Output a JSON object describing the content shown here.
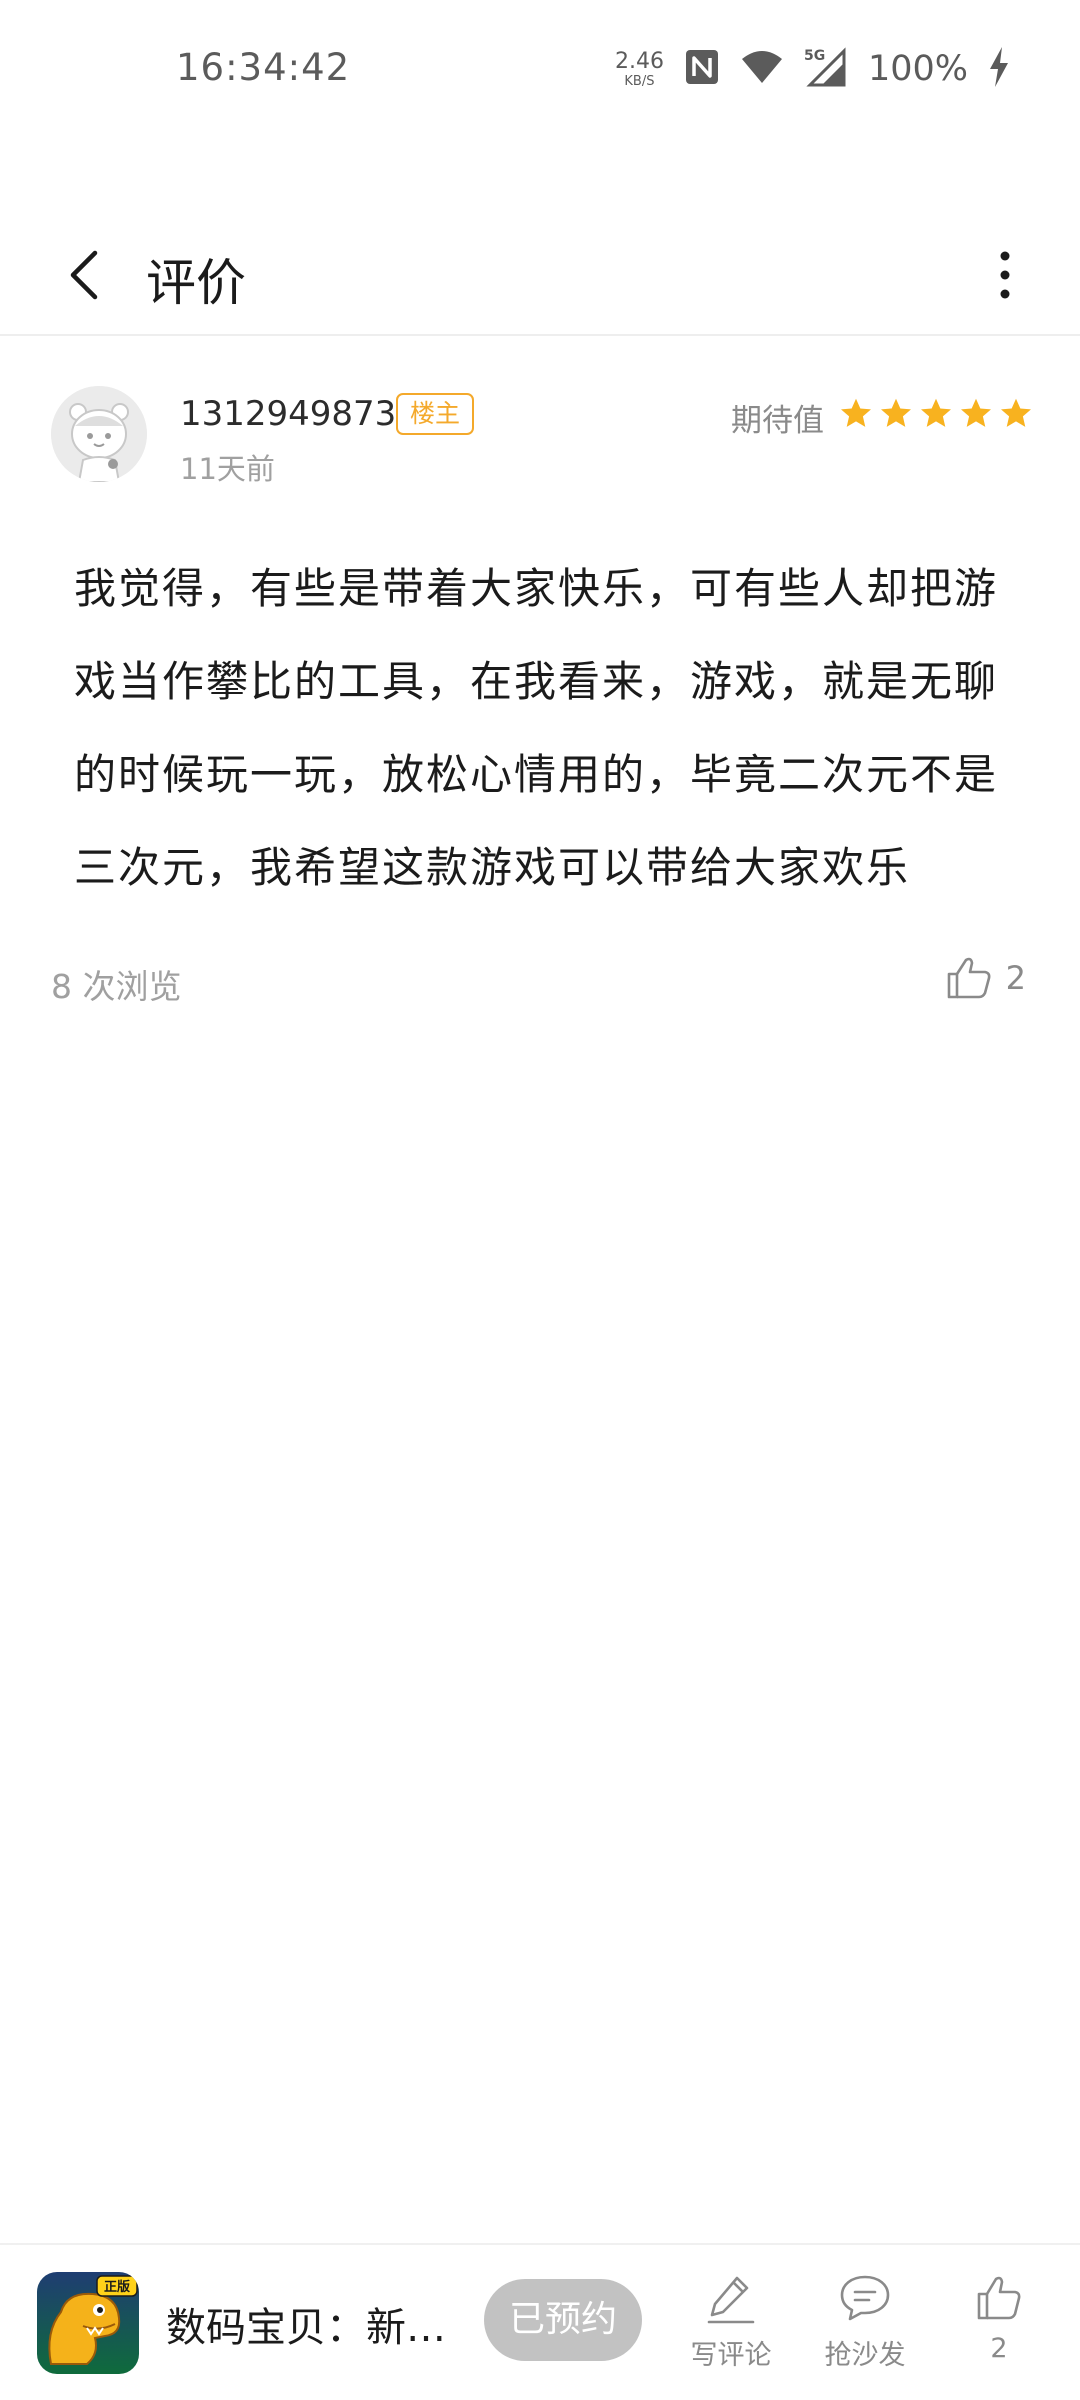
{
  "status_bar": {
    "time": "16:34:42",
    "net_speed_value": "2.46",
    "net_speed_unit": "KB/S",
    "network_type": "5G",
    "battery": "100%"
  },
  "header": {
    "title": "评价"
  },
  "review": {
    "username": "1312949873",
    "badge": "楼主",
    "time_ago": "11天前",
    "expect_label": "期待值",
    "rating": 5,
    "rating_max": 5,
    "star_color": "#f8b21f",
    "body": "我觉得，有些是带着大家快乐，可有些人却把游戏当作攀比的工具，在我看来，游戏，就是无聊的时候玩一玩，放松心情用的，毕竟二次元不是三次元，我希望这款游戏可以带给大家欢乐",
    "views": "8 次浏览",
    "likes": "2"
  },
  "bottom_bar": {
    "game_name": "数码宝贝：新…",
    "game_icon_badge": "正版",
    "reserve_label": "已预约",
    "actions": [
      {
        "label": "写评论",
        "icon": "pencil-icon"
      },
      {
        "label": "抢沙发",
        "icon": "chat-bubble-icon"
      },
      {
        "label": "2",
        "icon": "thumbs-up-icon"
      }
    ]
  }
}
